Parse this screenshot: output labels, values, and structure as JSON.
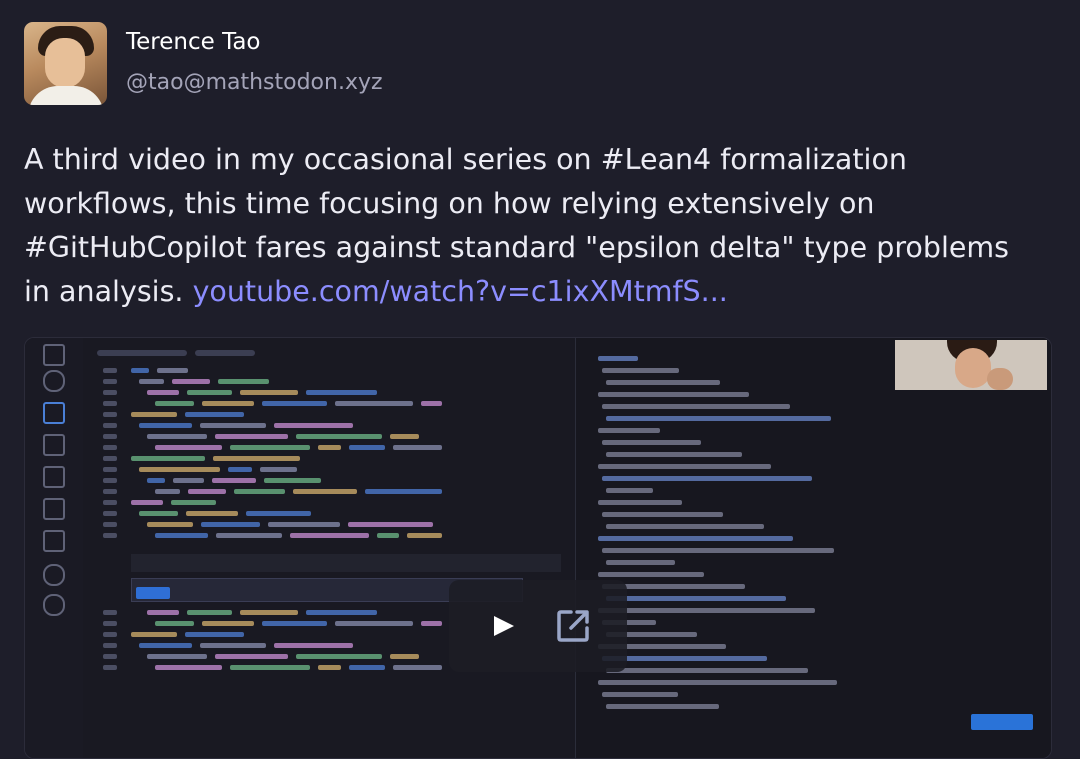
{
  "author": {
    "display_name": "Terence Tao",
    "handle": "@tao@mathstodon.xyz"
  },
  "post": {
    "text_1": "A third video in my occasional series on ",
    "hashtag_1": "#Lean4",
    "text_2": "  formalization workflows, this time focusing on how relying extensively on ",
    "hashtag_2": "#GitHubCopilot",
    "text_3": " fares against standard \"epsilon delta\" type problems in analysis.  ",
    "link_text": "youtube.com/watch?v=c1ixXMtmfS..."
  },
  "media": {
    "play_icon": "play-icon",
    "open_external_icon": "open-external-icon"
  },
  "colors": {
    "background": "#1e1e2a",
    "link": "#8c8dff",
    "handle": "#a4a4b8"
  }
}
